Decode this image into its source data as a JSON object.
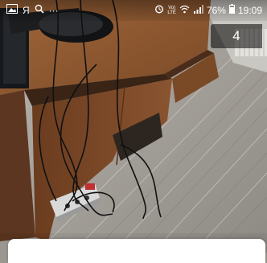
{
  "status_bar": {
    "left_icons": [
      "image-icon",
      "yandex-icon",
      "search-icon",
      "more-icon"
    ],
    "right_icons": [
      "alarm-icon",
      "volte-icon",
      "wifi-icon",
      "signal-icon"
    ],
    "yandex_glyph": "Я",
    "more_glyph": "···",
    "volte_line1": "Vo)",
    "volte_line2": "LTE",
    "battery": "76%",
    "time": "19:09"
  },
  "counter": {
    "value": "4"
  },
  "photo": {
    "subject": "photo-of-cables-under-desk"
  }
}
